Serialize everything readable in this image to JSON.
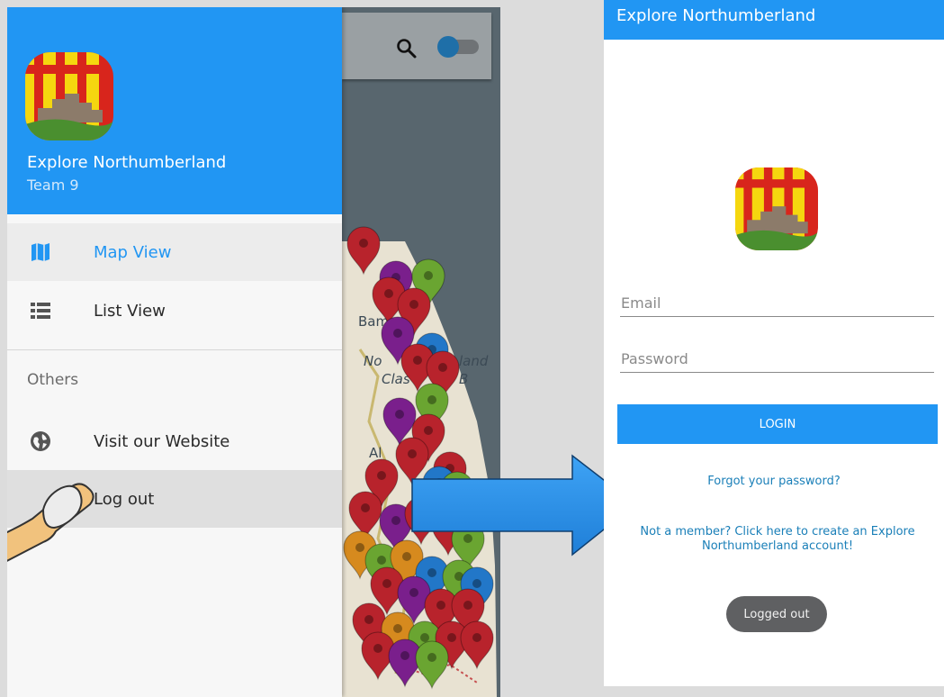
{
  "left_screen": {
    "drawer": {
      "app_name": "Explore Northumberland",
      "team": "Team 9",
      "items": [
        {
          "label": "Map View",
          "icon": "map-icon",
          "active": true
        },
        {
          "label": "List View",
          "icon": "list-icon"
        }
      ],
      "section_label": "Others",
      "other_items": [
        {
          "label": "Visit our Website",
          "icon": "globe-icon"
        },
        {
          "label": "Log out",
          "icon": "logout",
          "pressed": true
        }
      ]
    },
    "map": {
      "labels": [
        "Bambu",
        "No",
        "land",
        "Clas",
        "B",
        "Al"
      ],
      "toggle_on": true
    }
  },
  "right_screen": {
    "title": "Explore Northumberland",
    "email_placeholder": "Email",
    "password_placeholder": "Password",
    "login_label": "LOGIN",
    "forgot_label": "Forgot your password?",
    "signup_label": "Not a member? Click here to create an Explore Northumberland account!",
    "toast": "Logged out"
  },
  "colors": {
    "primary": "#2196f3",
    "arrow": "#2196f3",
    "link": "#1a7fb8",
    "pin_red": "#b8232c",
    "pin_purple": "#7a1f8c",
    "pin_green": "#6aa531",
    "pin_orange": "#d68a1e",
    "pin_blue": "#2277c8"
  }
}
